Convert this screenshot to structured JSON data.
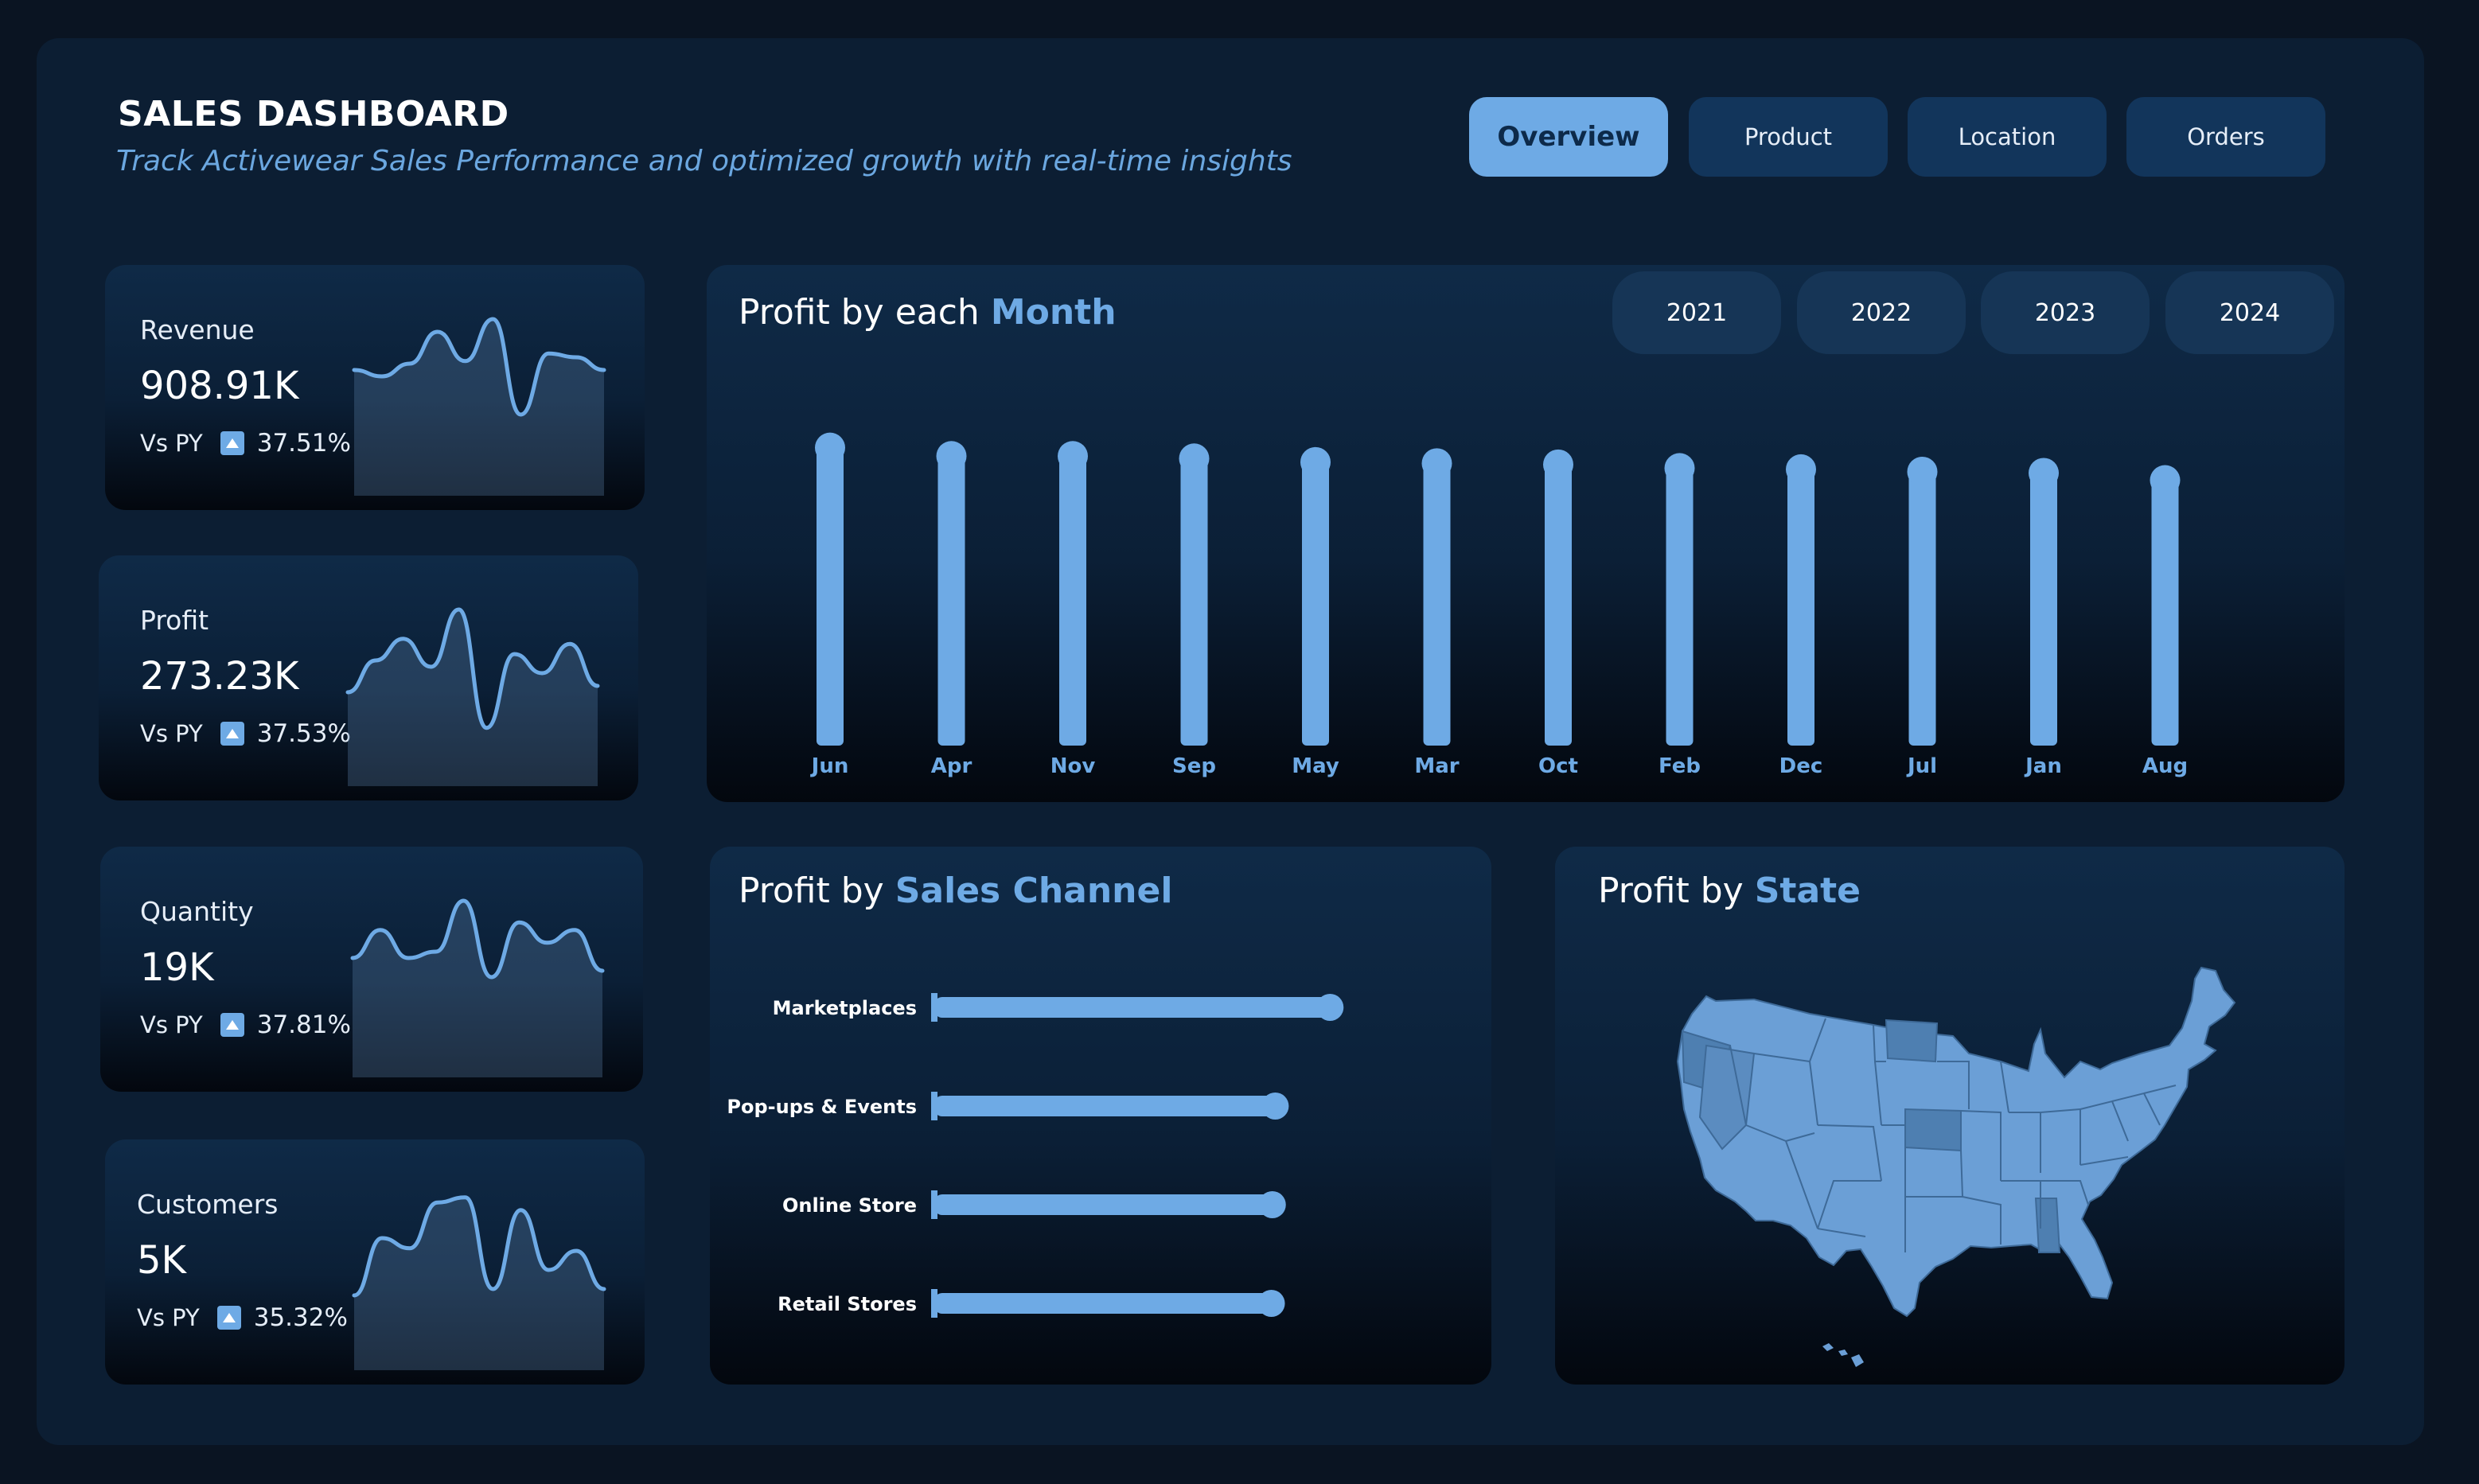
{
  "header": {
    "title": "SALES DASHBOARD",
    "subtitle": "Track Activewear Sales Performance and optimized growth with real-time insights"
  },
  "nav": [
    {
      "label": "Overview",
      "active": true
    },
    {
      "label": "Product",
      "active": false
    },
    {
      "label": "Location",
      "active": false
    },
    {
      "label": "Orders",
      "active": false
    }
  ],
  "kpis": [
    {
      "label": "Revenue",
      "value": "908.91K",
      "vs_label": "Vs PY",
      "change": "37.51%",
      "trend": [
        0.55,
        0.5,
        0.6,
        0.85,
        0.62,
        0.95,
        0.2,
        0.68,
        0.65,
        0.55
      ]
    },
    {
      "label": "Profit",
      "value": "273.23K",
      "vs_label": "Vs PY",
      "change": "37.53%",
      "trend": [
        0.3,
        0.55,
        0.72,
        0.5,
        0.95,
        0.02,
        0.6,
        0.45,
        0.68,
        0.35
      ]
    },
    {
      "label": "Quantity",
      "value": "19K",
      "vs_label": "Vs PY",
      "change": "37.81%",
      "trend": [
        0.5,
        0.72,
        0.5,
        0.55,
        0.95,
        0.35,
        0.78,
        0.62,
        0.72,
        0.4
      ]
    },
    {
      "label": "Customers",
      "value": "5K",
      "vs_label": "Vs PY",
      "change": "35.32%",
      "trend": [
        0.15,
        0.6,
        0.52,
        0.88,
        0.92,
        0.2,
        0.82,
        0.35,
        0.5,
        0.2
      ]
    }
  ],
  "monthly": {
    "title_prefix": "Profit by each",
    "title_highlight": "Month",
    "years": [
      "2021",
      "2022",
      "2023",
      "2024"
    ]
  },
  "channel": {
    "title_prefix": "Profit by",
    "title_highlight": "Sales Channel"
  },
  "state": {
    "title_prefix": "Profit by",
    "title_highlight": "State"
  },
  "colors": {
    "accent": "#6eaae5",
    "background": "#0a1422",
    "panel": "#0c1e33",
    "button": "#12355b"
  },
  "chart_data": [
    {
      "type": "bar",
      "orientation": "vertical",
      "categories": [
        "Jun",
        "Apr",
        "Nov",
        "Sep",
        "May",
        "Mar",
        "Oct",
        "Feb",
        "Dec",
        "Jul",
        "Jan",
        "Aug"
      ],
      "values": [
        25.1,
        24.4,
        24.4,
        24.2,
        23.9,
        23.8,
        23.7,
        23.4,
        23.3,
        23.1,
        23.0,
        22.4
      ],
      "ylim": [
        0,
        26
      ],
      "grid": false,
      "legend": "none"
    },
    {
      "type": "bar",
      "orientation": "horizontal",
      "categories": [
        "Marketplaces",
        "Pop-ups & Events",
        "Online Store",
        "Retail Stores"
      ],
      "values": [
        81.6,
        70.3,
        69.7,
        69.5
      ],
      "xlim": [
        0,
        85
      ],
      "grid": false,
      "legend": "none"
    },
    {
      "type": "map",
      "region": "United States",
      "legend": "none"
    }
  ]
}
